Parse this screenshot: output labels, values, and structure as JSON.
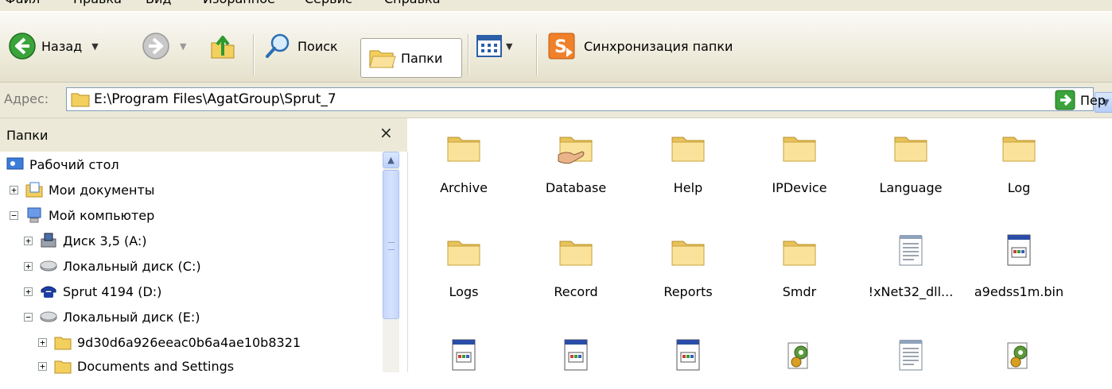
{
  "menu": [
    "Файл",
    "Правка",
    "Вид",
    "Избранное",
    "Сервис",
    "Справка"
  ],
  "toolbar": {
    "back_label": "Назад",
    "search_label": "Поиск",
    "folders_label": "Папки",
    "sync_label": "Синхронизация папки"
  },
  "address": {
    "label": "Адрес:",
    "path": "E:\\Program Files\\AgatGroup\\Sprut_7",
    "go_label": "Пер"
  },
  "folder_pane": {
    "title": "Папки",
    "close": "×",
    "tree": [
      {
        "label": "Рабочий стол",
        "icon": "desktop-icon",
        "expander": ""
      },
      {
        "label": "Мои документы",
        "icon": "my-documents-icon",
        "expander": "+"
      },
      {
        "label": "Мой компьютер",
        "icon": "my-computer-icon",
        "expander": "−"
      },
      {
        "label": "Диск 3,5 (A:)",
        "icon": "floppy-drive-icon",
        "expander": "+"
      },
      {
        "label": "Локальный диск (C:)",
        "icon": "hard-drive-icon",
        "expander": "+"
      },
      {
        "label": "Sprut 4194 (D:)",
        "icon": "phone-drive-icon",
        "expander": "+"
      },
      {
        "label": "Локальный диск (E:)",
        "icon": "hard-drive-icon",
        "expander": "−"
      },
      {
        "label": "9d30d6a926eeac0b6a4ae10b8321",
        "icon": "folder-icon",
        "expander": "+"
      },
      {
        "label": "Documents and Settings",
        "icon": "folder-icon",
        "expander": "+"
      }
    ]
  },
  "files": [
    {
      "name": "Archive",
      "icon": "folder-icon"
    },
    {
      "name": "Database",
      "icon": "shared-folder-icon"
    },
    {
      "name": "Help",
      "icon": "folder-icon"
    },
    {
      "name": "IPDevice",
      "icon": "folder-icon"
    },
    {
      "name": "Language",
      "icon": "folder-icon"
    },
    {
      "name": "Log",
      "icon": "folder-icon"
    },
    {
      "name": "Logs",
      "icon": "folder-icon"
    },
    {
      "name": "Record",
      "icon": "folder-icon"
    },
    {
      "name": "Reports",
      "icon": "folder-icon"
    },
    {
      "name": "Smdr",
      "icon": "folder-icon"
    },
    {
      "name": "!xNet32_dll...",
      "icon": "text-file-icon"
    },
    {
      "name": "a9edss1m.bin",
      "icon": "binary-file-icon"
    },
    {
      "name": "",
      "icon": "binary-file-icon"
    },
    {
      "name": "",
      "icon": "binary-file-icon"
    },
    {
      "name": "",
      "icon": "binary-file-icon"
    },
    {
      "name": "",
      "icon": "config-file-icon"
    },
    {
      "name": "",
      "icon": "text-file-icon"
    },
    {
      "name": "",
      "icon": "config-file-icon"
    }
  ],
  "colors": {
    "toolbar_bg": "#ece9d8",
    "folder_yellow": "#f8d775",
    "scroll_blue": "#c5d6fc"
  }
}
